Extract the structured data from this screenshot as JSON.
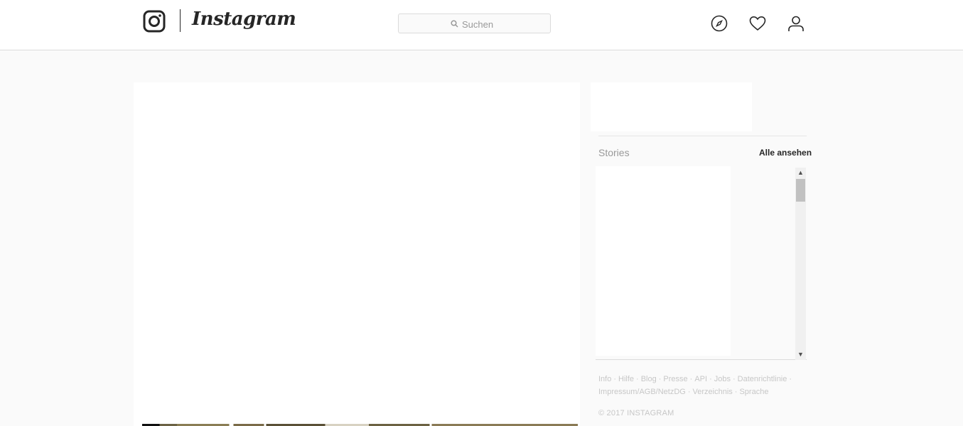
{
  "header": {
    "brand": "Instagram",
    "search": {
      "placeholder": "Suchen",
      "value": ""
    },
    "nav_icons": [
      "explore-compass-icon",
      "activity-heart-icon",
      "profile-person-icon"
    ]
  },
  "sidebar": {
    "stories_title": "Stories",
    "see_all_label": "Alle ansehen"
  },
  "footer": {
    "links": [
      "Info",
      "Hilfe",
      "Blog",
      "Presse",
      "API",
      "Jobs",
      "Datenrichtlinie",
      "Impressum/AGB/NetzDG",
      "Verzeichnis",
      "Sprache"
    ],
    "copyright": "© 2017 INSTAGRAM"
  },
  "colors": {
    "background": "#fafafa",
    "border": "#dbdbdb",
    "text_primary": "#262626",
    "text_muted": "#999999",
    "footer_text": "#c7c7c7"
  }
}
